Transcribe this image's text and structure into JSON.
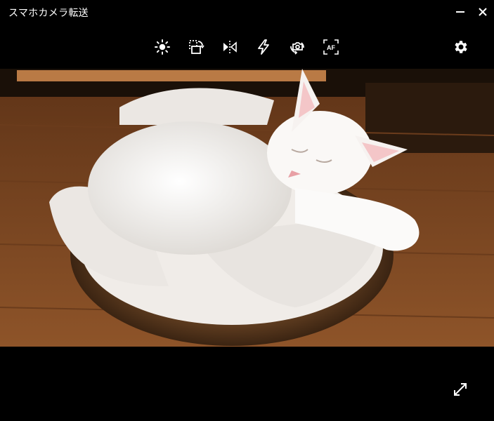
{
  "window": {
    "title": "スマホカメラ転送"
  },
  "icons": {
    "minimize": "minimize-icon",
    "close": "close-icon",
    "brightness": "brightness-icon",
    "rotate": "rotate-icon",
    "flip": "flip-horizontal-icon",
    "flash": "flash-icon",
    "switch_camera": "switch-camera-icon",
    "autofocus": "autofocus-icon",
    "settings": "gear-icon",
    "fullscreen": "fullscreen-icon"
  },
  "toolbar": {
    "autofocus_label": "AF"
  },
  "colors": {
    "background": "#000000",
    "icon": "#ffffff"
  }
}
